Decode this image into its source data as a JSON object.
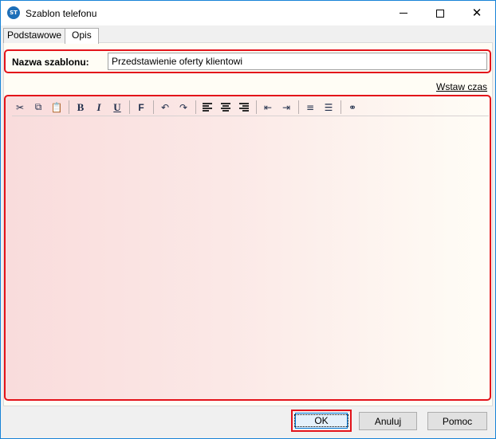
{
  "window": {
    "title": "Szablon telefonu",
    "icon_name": "app-logo-icon",
    "icon_text": "ST",
    "controls": [
      "minimize-icon",
      "maximize-icon",
      "close-icon"
    ],
    "close_glyph": "✕"
  },
  "tabs": [
    {
      "label": "Podstawowe",
      "active": false
    },
    {
      "label": "Opis",
      "active": true
    }
  ],
  "form": {
    "name_label": "Nazwa szablonu:",
    "name_value": "Przedstawienie oferty klientowi"
  },
  "insert_time_link": "Wstaw czas",
  "editor": {
    "toolbar": {
      "cut_glyph": "✂",
      "copy_glyph": "⧉",
      "paste_glyph": "📋",
      "bold": "B",
      "italic": "I",
      "underline": "U",
      "font": "F",
      "undo_glyph": "↶",
      "redo_glyph": "↷",
      "outdent_glyph": "⇤",
      "indent_glyph": "⇥",
      "numbered_glyph": "≡",
      "bullets_glyph": "☰",
      "link_glyph": "⚭"
    },
    "content": ""
  },
  "buttons": {
    "ok": "OK",
    "cancel": "Anuluj",
    "help": "Pomoc"
  },
  "colors": {
    "highlight": "#e3131a",
    "title_border": "#1883d7"
  }
}
